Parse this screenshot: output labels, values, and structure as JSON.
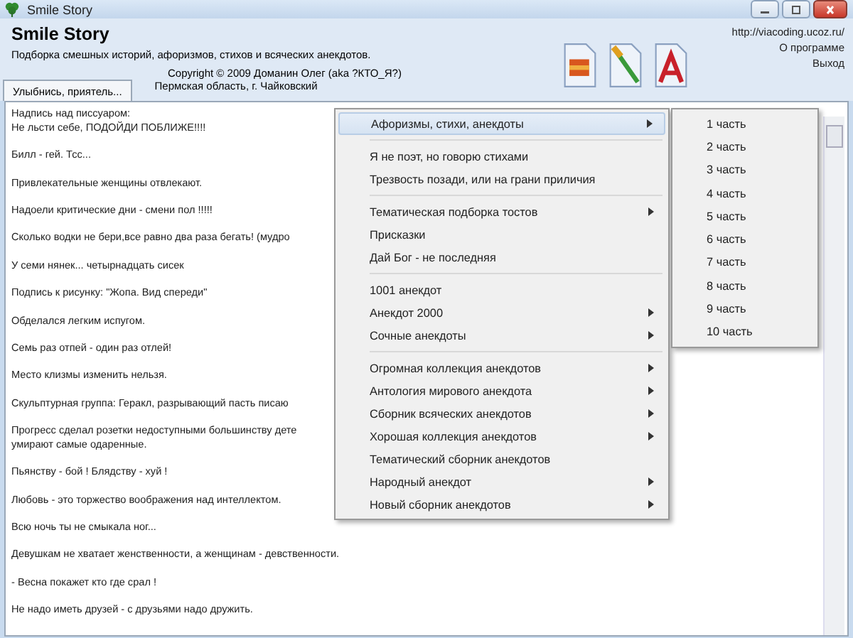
{
  "window": {
    "title": "Smile Story"
  },
  "header": {
    "title": "Smile Story",
    "subtitle": "Подборка смешных историй, афоризмов, стихов и всяческих анекдотов.",
    "copyright": "Copyright © 2009 Доманин Олег (aka ?КТО_Я?)",
    "location": "Пермская область, г. Чайковский"
  },
  "links": [
    "http://viacoding.ucoz.ru/",
    "О программе",
    "Выход"
  ],
  "tabs": [
    {
      "label": "Улыбнись, приятель...",
      "selected": true
    }
  ],
  "jokes": [
    {
      "lines": [
        "Надпись над писсуаром:",
        "Не льсти себе, ПОДОЙДИ ПОБЛИЖЕ!!!!"
      ]
    },
    {
      "lines": [
        "Билл - гей. Тсс..."
      ]
    },
    {
      "lines": [
        "Привлекательные женщины отвлекают."
      ]
    },
    {
      "lines": [
        "Надоели критические дни - смени пол !!!!!"
      ]
    },
    {
      "lines": [
        "Сколько водки не бери,все равно два раза бегать! (мудро"
      ]
    },
    {
      "lines": [
        "У семи нянек... четырнадцать сисек"
      ]
    },
    {
      "lines": [
        "Подпись к рисунку: \"Жопа. Вид спереди\""
      ]
    },
    {
      "lines": [
        "Обделался легким испугом."
      ]
    },
    {
      "lines": [
        "Семь раз отпей - один раз отлей!"
      ]
    },
    {
      "lines": [
        "Место клизмы изменить нельзя."
      ]
    },
    {
      "lines": [
        "Скульптурная группа: Геракл, разрывающий пасть писаю"
      ]
    },
    {
      "lines": [
        "Прогресс сделал розетки недоступными большинству дете",
        "умирают самые одаренные."
      ]
    },
    {
      "lines": [
        "Пьянству - бой ! Блядству - хуй !"
      ]
    },
    {
      "lines": [
        "Любовь - это торжество воображения над интеллектом."
      ]
    },
    {
      "lines": [
        "Всю ночь ты не смыкала ног..."
      ]
    },
    {
      "lines": [
        "Девушкам не хватает женственности, а женщинам - девственности."
      ]
    },
    {
      "lines": [
        "- Весна покажет кто где срал !"
      ]
    },
    {
      "lines": [
        "Не надо иметь друзей - с друзьями надо дружить."
      ]
    }
  ],
  "menu": {
    "items": [
      {
        "kind": "item",
        "label": "Афоризмы, стихи, анекдоты",
        "submenu": true,
        "selected": true
      },
      {
        "kind": "separator"
      },
      {
        "kind": "item",
        "label": "Я не поэт, но говорю стихами",
        "submenu": false,
        "selected": false
      },
      {
        "kind": "item",
        "label": "Трезвость позади, или на грани приличия",
        "submenu": false,
        "selected": false
      },
      {
        "kind": "separator"
      },
      {
        "kind": "item",
        "label": "Тематическая подборка тостов",
        "submenu": true,
        "selected": false
      },
      {
        "kind": "item",
        "label": "Присказки",
        "submenu": false,
        "selected": false
      },
      {
        "kind": "item",
        "label": "Дай Бог - не последняя",
        "submenu": false,
        "selected": false
      },
      {
        "kind": "separator"
      },
      {
        "kind": "item",
        "label": "1001 анекдот",
        "submenu": false,
        "selected": false
      },
      {
        "kind": "item",
        "label": "Анекдот 2000",
        "submenu": true,
        "selected": false
      },
      {
        "kind": "item",
        "label": "Сочные анекдоты",
        "submenu": true,
        "selected": false
      },
      {
        "kind": "separator"
      },
      {
        "kind": "item",
        "label": "Огромная коллекция анекдотов",
        "submenu": true,
        "selected": false
      },
      {
        "kind": "item",
        "label": "Антология мирового анекдота",
        "submenu": true,
        "selected": false
      },
      {
        "kind": "item",
        "label": "Сборник всяческих анекдотов",
        "submenu": true,
        "selected": false
      },
      {
        "kind": "item",
        "label": "Хорошая коллекция анекдотов",
        "submenu": true,
        "selected": false
      },
      {
        "kind": "item",
        "label": "Тематический сборник анекдотов",
        "submenu": false,
        "selected": false
      },
      {
        "kind": "item",
        "label": "Народный анекдот",
        "submenu": true,
        "selected": false
      },
      {
        "kind": "item",
        "label": "Новый сборник анекдотов",
        "submenu": true,
        "selected": false
      }
    ]
  },
  "submenu": {
    "items": [
      {
        "label": "1 часть",
        "selected": false
      },
      {
        "label": "2 часть",
        "selected": false
      },
      {
        "label": "3 часть",
        "selected": false
      },
      {
        "label": "4 часть",
        "selected": false
      },
      {
        "label": "5 часть",
        "selected": false
      },
      {
        "label": "6 часть",
        "selected": false
      },
      {
        "label": "7 часть",
        "selected": false
      },
      {
        "label": "8 часть",
        "selected": false
      },
      {
        "label": "9 часть",
        "selected": false
      },
      {
        "label": "10 часть",
        "selected": false
      }
    ]
  }
}
